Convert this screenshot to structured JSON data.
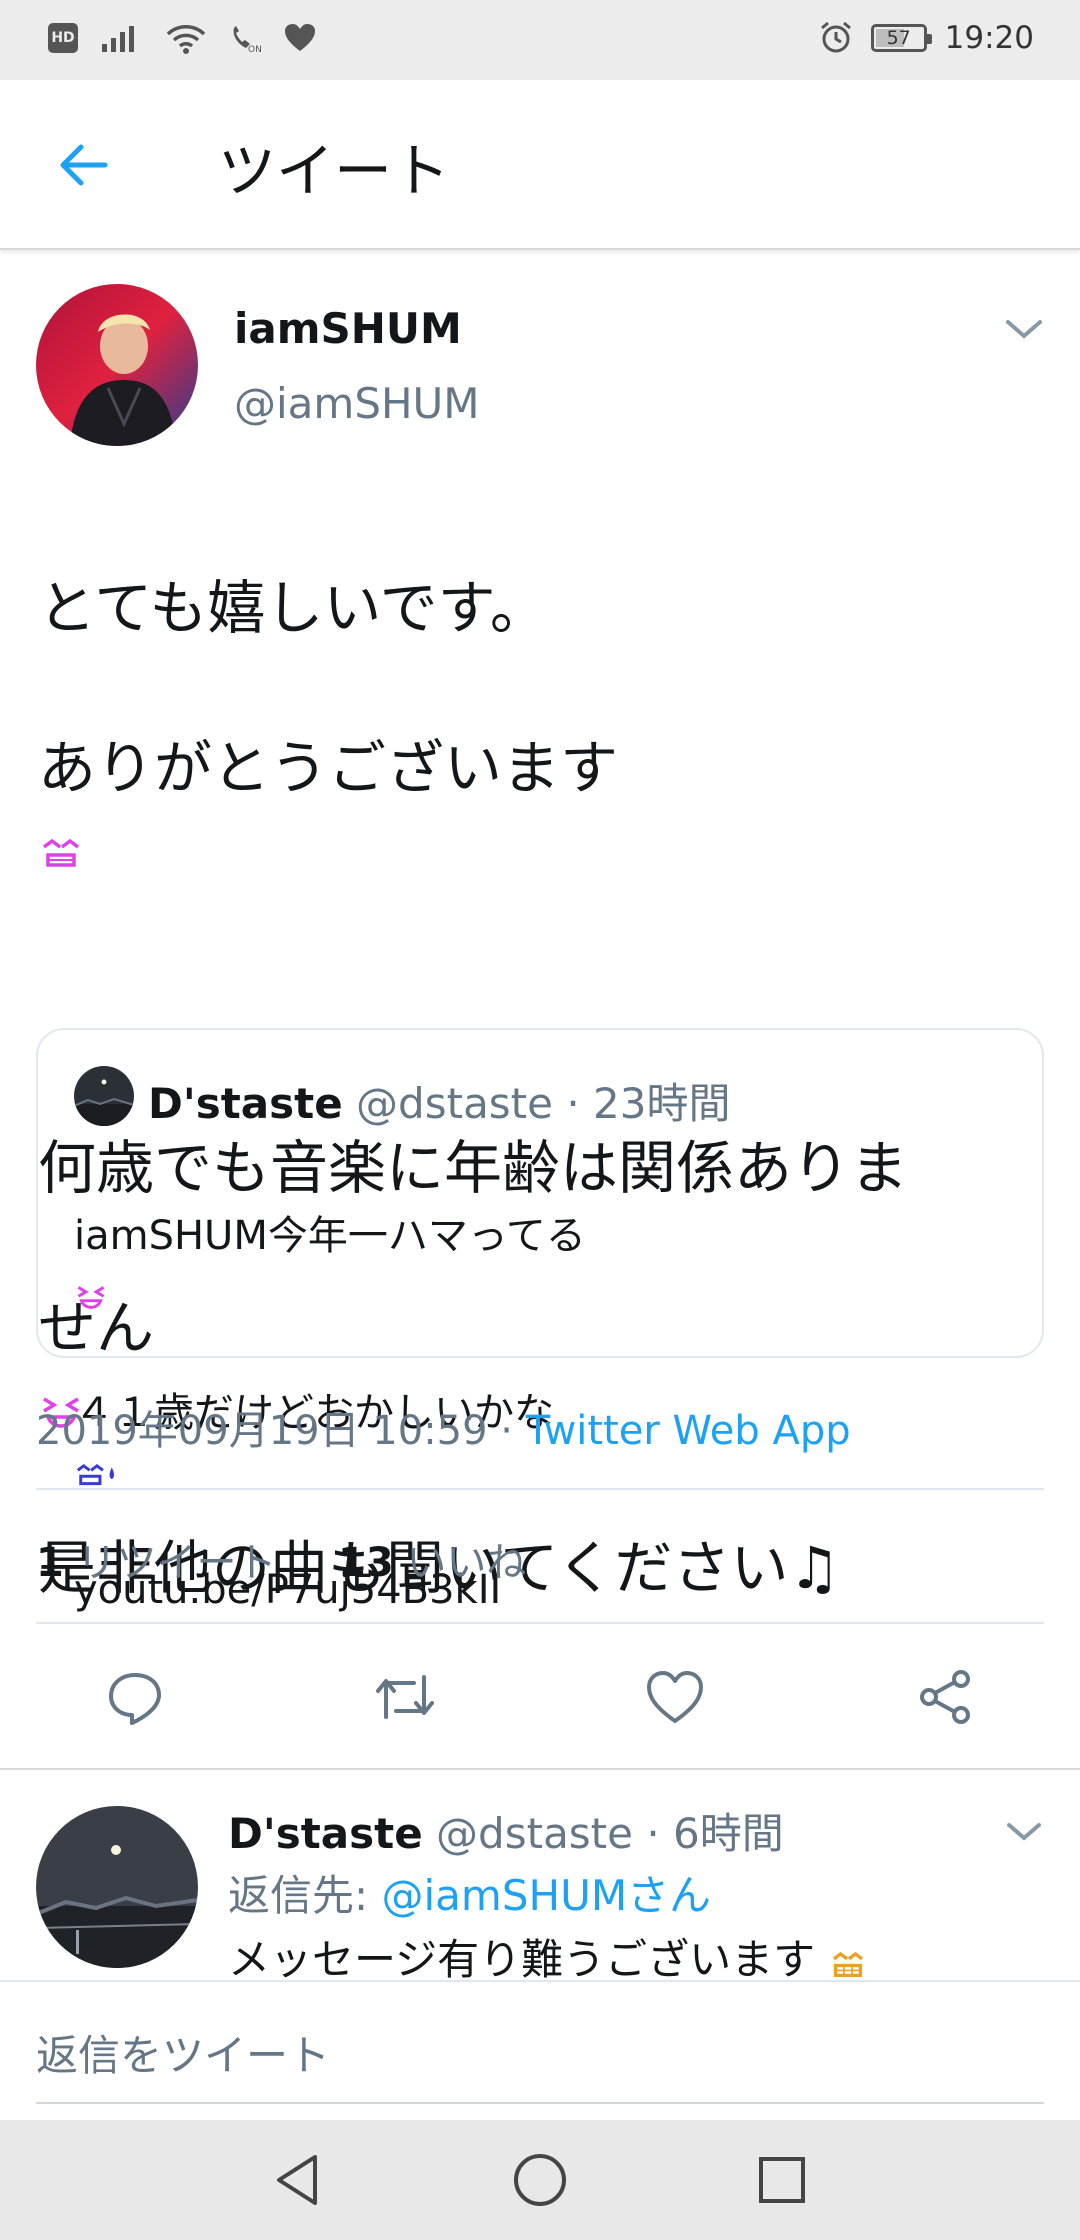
{
  "status_bar": {
    "time": "19:20",
    "battery_level": "57",
    "hd_label": "HD",
    "icons": [
      "hd-icon",
      "signal-icon",
      "wifi-icon",
      "volte-icon",
      "heart-icon",
      "alarm-icon",
      "battery-icon"
    ]
  },
  "app_bar": {
    "title": "ツイート",
    "back_icon": "arrow-left-icon"
  },
  "tweet": {
    "author_name": "iamSHUM",
    "author_handle": "@iamSHUM",
    "text_line1": "とても嬉しいです。",
    "text_line2": "ありがとうございます",
    "text_line3": "何歳でも音楽に年齢は関係ありま",
    "text_line4": "せん",
    "text_line5": "是非他の曲も聞いてください♫",
    "timestamp": "2019年09月19日 10:59",
    "separator": " · ",
    "via": "Twitter Web App",
    "retweet_count": "1",
    "retweet_label": " リツイート",
    "like_count": "13",
    "like_label": " いいね"
  },
  "quoted_tweet": {
    "name": "D'staste",
    "handle_time": " @dstaste · 23時間",
    "line1": "iamSHUM今年一ハマってる",
    "line2": "４１歳だけどおかしいかな",
    "line3": "youtu.be/P7uj54B3kII"
  },
  "actions": [
    "reply-icon",
    "retweet-icon",
    "like-icon",
    "share-icon"
  ],
  "reply": {
    "name": "D'staste",
    "handle_time": " @dstaste · 6時間",
    "reply_to_prefix": "返信先: ",
    "reply_to_mention": "@iamSHUMさん",
    "text": "メッセージ有り難うございます"
  },
  "composer": {
    "placeholder": "返信をツイート"
  },
  "colors": {
    "accent": "#1da1f2",
    "secondary_text": "#657786",
    "primary_text": "#14171a",
    "divider": "#e1e8ed"
  }
}
